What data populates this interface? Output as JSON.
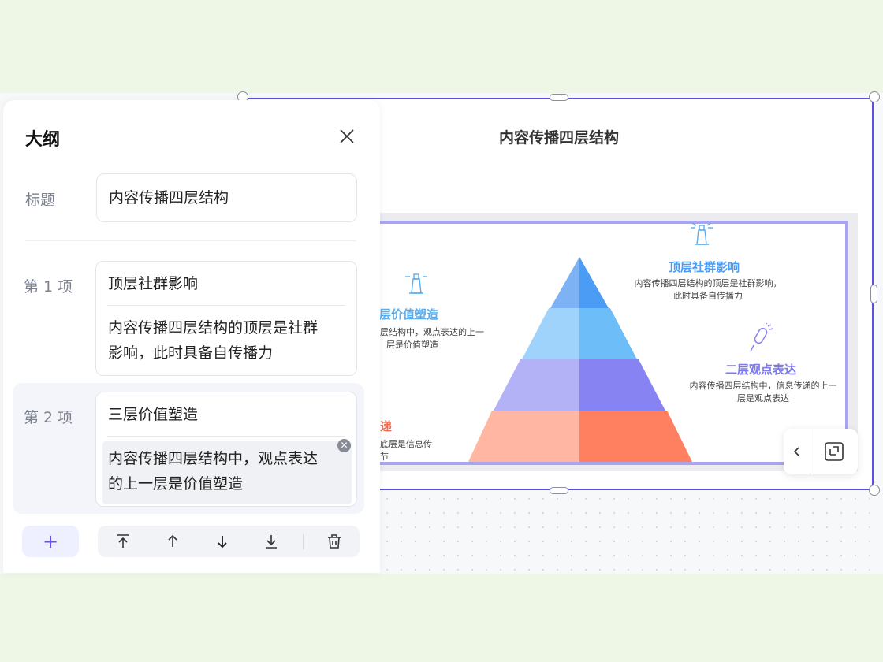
{
  "outline": {
    "title": "大纲",
    "title_label": "标题",
    "title_value": "内容传播四层结构",
    "items": [
      {
        "label": "第 1 项",
        "heading": "顶层社群影响",
        "desc_lines": [
          "内容传播四层结构的顶层是社群",
          "影响，此时具备自传播力"
        ]
      },
      {
        "label": "第 2 项",
        "heading": "三层价值塑造",
        "desc_lines": [
          "内容传播四层结构中，观点表达",
          "的上一层是价值塑造"
        ]
      }
    ],
    "add_symbol": "+"
  },
  "slide": {
    "title": "内容传播四层结构",
    "levels": [
      {
        "name": "顶层社群影响",
        "desc_lines": [
          "内容传播四层结构的顶层是社群影响，",
          "此时具备自传播力"
        ],
        "color": "#4a9cf5"
      },
      {
        "name": "三层价值塑造",
        "desc_lines": [
          "层结构中，观点表达的上一",
          "层是价值塑造"
        ],
        "color": "#5aaef0"
      },
      {
        "name": "二层观点表达",
        "desc_lines": [
          "内容传播四层结构中，信息传递的上一",
          "层是观点表达"
        ],
        "color": "#7c78ee"
      },
      {
        "name": "递",
        "desc_lines": [
          "底层是信息传",
          "节"
        ],
        "color": "#f26a4f"
      }
    ]
  },
  "colors": {
    "accent": "#5b4fe0",
    "pyramid_top": "#4a9cf5",
    "pyramid_bottom": "#ff7f61"
  }
}
